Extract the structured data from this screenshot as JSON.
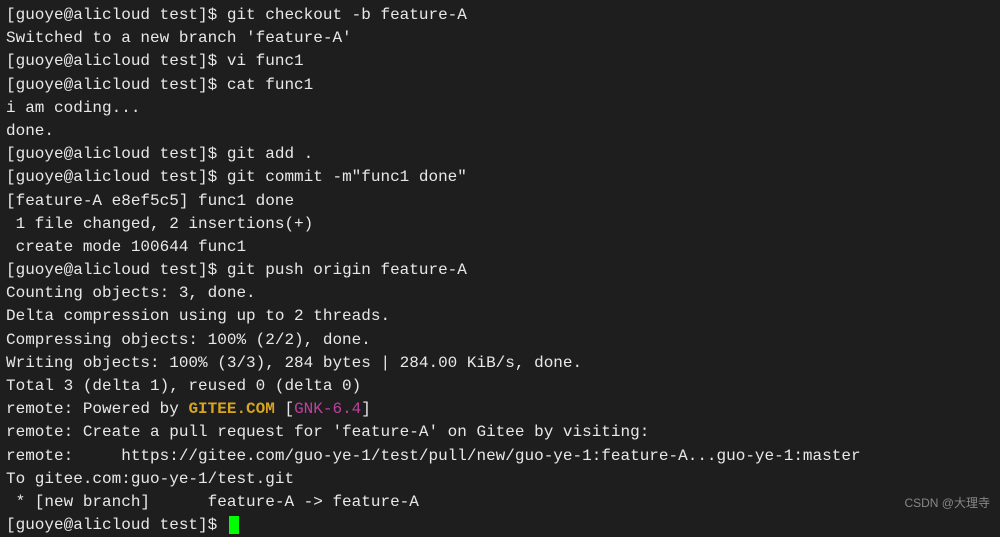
{
  "prompt": "[guoye@alicloud test]$ ",
  "lines": {
    "l1_cmd": "git checkout -b feature-A",
    "l2": "Switched to a new branch 'feature-A'",
    "l3_cmd": "vi func1",
    "l4_cmd": "cat func1",
    "l5": "i am coding...",
    "l6": "done.",
    "l7_cmd": "git add .",
    "l8_cmd": "git commit -m\"func1 done\"",
    "l9": "[feature-A e8ef5c5] func1 done",
    "l10": " 1 file changed, 2 insertions(+)",
    "l11": " create mode 100644 func1",
    "l12_cmd": "git push origin feature-A",
    "l13": "Counting objects: 3, done.",
    "l14": "Delta compression using up to 2 threads.",
    "l15": "Compressing objects: 100% (2/2), done.",
    "l16": "Writing objects: 100% (3/3), 284 bytes | 284.00 KiB/s, done.",
    "l17": "Total 3 (delta 1), reused 0 (delta 0)",
    "l18_a": "remote: Powered by ",
    "l18_b": "GITEE.COM",
    "l18_c": " [",
    "l18_d": "GNK-6.4",
    "l18_e": "]",
    "l19": "remote: Create a pull request for 'feature-A' on Gitee by visiting:",
    "l20": "remote:     https://gitee.com/guo-ye-1/test/pull/new/guo-ye-1:feature-A...guo-ye-1:master",
    "l21": "To gitee.com:guo-ye-1/test.git",
    "l22": " * [new branch]      feature-A -> feature-A"
  },
  "watermark": "CSDN @大理寺"
}
